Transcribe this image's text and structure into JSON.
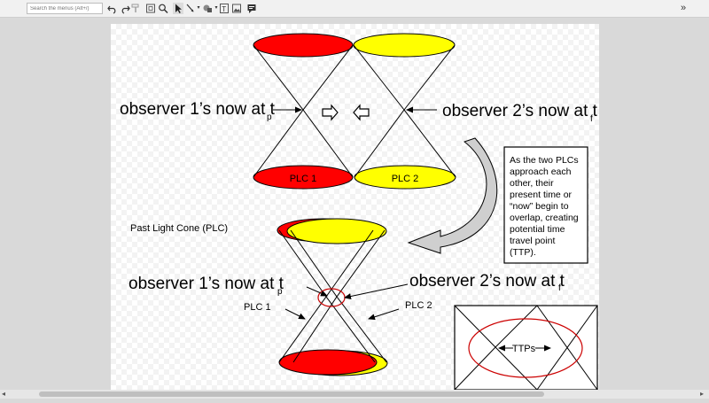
{
  "toolbar": {
    "search_placeholder": "Search the menus (Alt+/)",
    "expand_glyph": "»"
  },
  "diagram": {
    "top": {
      "obs1_label": "observer 1’s now at t",
      "obs1_sub": "p",
      "obs2_label": "observer 2’s now at t",
      "obs2_sub": "f",
      "plc1": "PLC 1",
      "plc2": "PLC 2"
    },
    "plc_label": "Past Light Cone (PLC)",
    "note": [
      "As the two PLCs",
      "approach each",
      "other, their",
      "present time or",
      "“now” begin to",
      "overlap, creating",
      "potential time",
      "travel point",
      "(TTP)."
    ],
    "bottom": {
      "obs1_label": "observer 1’s now at t",
      "obs1_sub": "p",
      "obs2_label": "observer 2’s now at t",
      "obs2_sub": "f",
      "plc1": "PLC 1",
      "plc2": "PLC 2"
    },
    "ttps": "TTPs"
  },
  "colors": {
    "red": "#ff0000",
    "yellow": "#ffff00",
    "circle": "#cc0000"
  }
}
